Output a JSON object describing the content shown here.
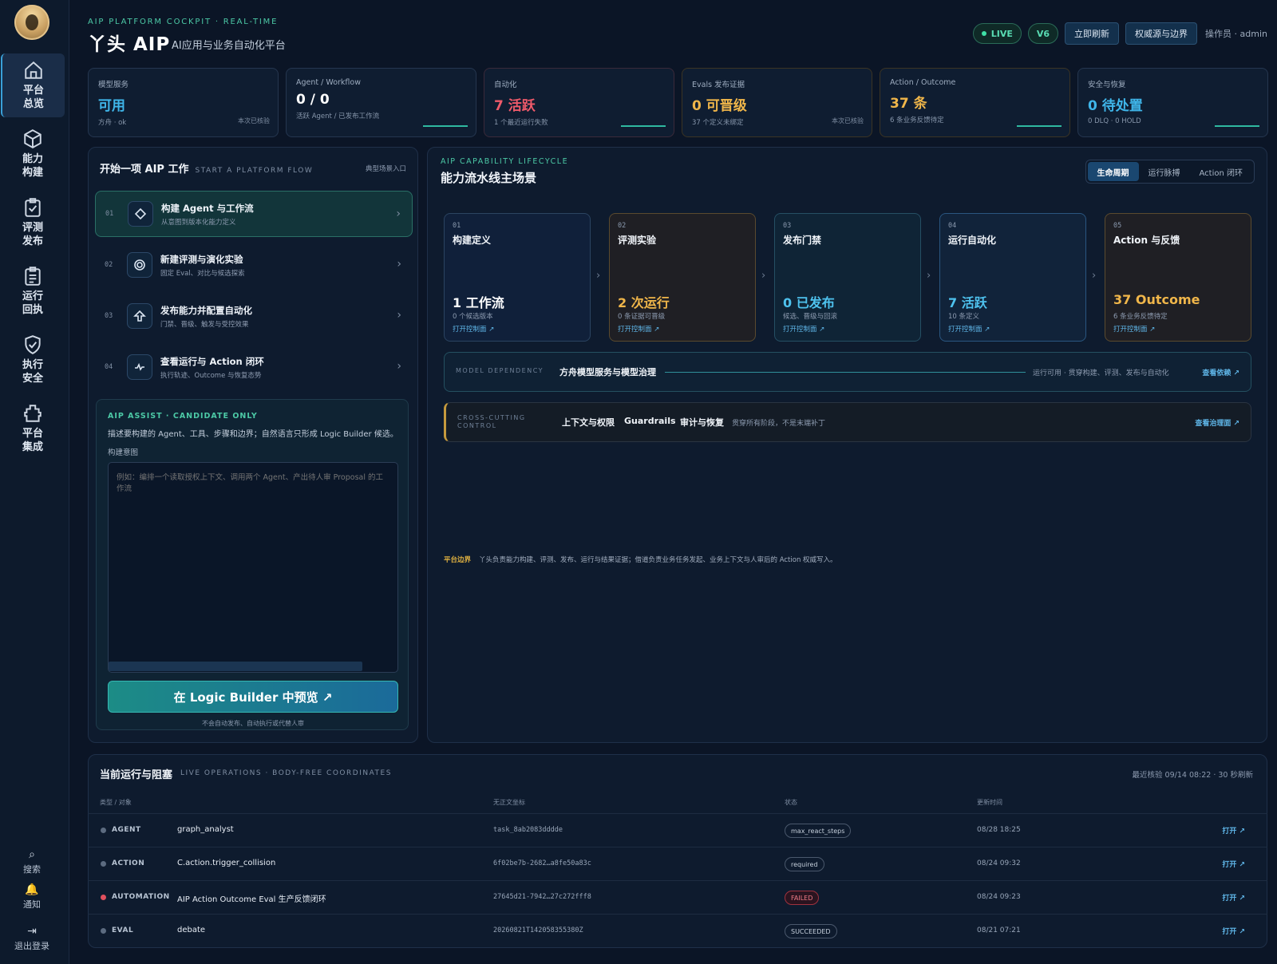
{
  "sidebar": {
    "items": [
      {
        "label": "平台总览",
        "icon": "home-icon"
      },
      {
        "label": "能力构建",
        "icon": "cube-icon"
      },
      {
        "label": "评测发布",
        "icon": "clipboard-check-icon"
      },
      {
        "label": "运行回执",
        "icon": "clipboard-list-icon"
      },
      {
        "label": "执行安全",
        "icon": "shield-check-icon"
      },
      {
        "label": "平台集成",
        "icon": "puzzle-icon"
      }
    ],
    "bottom": [
      {
        "label": "搜索",
        "glyph": "⌕",
        "icon": "search-icon"
      },
      {
        "label": "通知",
        "glyph": "🔔",
        "icon": "bell-icon"
      },
      {
        "label": "退出登录",
        "glyph": "⇥",
        "icon": "logout-icon"
      }
    ]
  },
  "header": {
    "kicker": "AIP PLATFORM COCKPIT · REAL-TIME",
    "brand": "丫头 AIP",
    "subtitle": "AI应用与业务自动化平台",
    "live": "LIVE",
    "version": "V6",
    "refresh": "立即刷新",
    "authority": "权威源与边界",
    "operator": "操作员 · admin"
  },
  "stats": [
    {
      "label": "模型服务",
      "value": "可用",
      "sub": "方舟 · ok",
      "corner": "本次已核验",
      "color": "#3fb6ea"
    },
    {
      "label": "Agent / Workflow",
      "value": "0 / 0",
      "sub": "活跃 Agent / 已发布工作流",
      "corner": "",
      "color": "#ffffff"
    },
    {
      "label": "自动化",
      "value": "7 活跃",
      "sub": "1 个最近运行失败",
      "corner": "",
      "color": "#ef5a6a"
    },
    {
      "label": "Evals 发布证据",
      "value": "0 可晋级",
      "sub": "37 个定义未绑定",
      "corner": "本次已核验",
      "color": "#f0b64a"
    },
    {
      "label": "Action / Outcome",
      "value": "37 条",
      "sub": "6 条业务反馈待定",
      "corner": "",
      "color": "#f0b64a"
    },
    {
      "label": "安全与恢复",
      "value": "0 待处置",
      "sub": "0 DLQ · 0 HOLD",
      "corner": "",
      "color": "#3fb6ea"
    }
  ],
  "flow": {
    "title": "开始一项 AIP 工作",
    "kicker": "START A PLATFORM FLOW",
    "right": "典型场景入口",
    "items": [
      {
        "num": "01",
        "title": "构建 Agent 与工作流",
        "sub": "从意图到版本化能力定义"
      },
      {
        "num": "02",
        "title": "新建评测与演化实验",
        "sub": "固定 Eval、对比与候选探索"
      },
      {
        "num": "03",
        "title": "发布能力并配置自动化",
        "sub": "门禁、晋级、触发与受控效果"
      },
      {
        "num": "04",
        "title": "查看运行与 Action 闭环",
        "sub": "执行轨迹、Outcome 与恢复态势"
      }
    ]
  },
  "assist": {
    "kicker": "AIP ASSIST · CANDIDATE ONLY",
    "desc": "描述要构建的 Agent、工具、步骤和边界；自然语言只形成 Logic Builder 候选。",
    "field": "构建意图",
    "placeholder": "例如：编排一个读取授权上下文、调用两个 Agent、产出待人审 Proposal 的工作流",
    "cta": "在 Logic Builder 中预览 ↗",
    "note": "不会自动发布、自动执行或代替人审"
  },
  "lifecycle": {
    "kicker": "AIP CAPABILITY LIFECYCLE",
    "title": "能力流水线主场景",
    "tabs": [
      "生命周期",
      "运行脉搏",
      "Action 闭环"
    ],
    "stages": [
      {
        "no": "01",
        "name": "构建定义",
        "metric": "1 工作流",
        "sub": "0 个候选版本",
        "link": "打开控制面 ↗",
        "color": "#ffffff"
      },
      {
        "no": "02",
        "name": "评测实验",
        "metric": "2 次运行",
        "sub": "0 条证据可晋级",
        "link": "打开控制面 ↗",
        "color": "#f0b64a"
      },
      {
        "no": "03",
        "name": "发布门禁",
        "metric": "0 已发布",
        "sub": "候选、晋级与回滚",
        "link": "打开控制面 ↗",
        "color": "#4ec2ee"
      },
      {
        "no": "04",
        "name": "运行自动化",
        "metric": "7 活跃",
        "sub": "10 条定义",
        "link": "打开控制面 ↗",
        "color": "#4ec2ee"
      },
      {
        "no": "05",
        "name": "Action 与反馈",
        "metric": "37 Outcome",
        "sub": "6 条业务反馈待定",
        "link": "打开控制面 ↗",
        "color": "#f0b64a"
      }
    ],
    "dependency": {
      "kicker": "MODEL DEPENDENCY",
      "title": "方舟模型服务与模型治理",
      "desc": "运行可用 · 贯穿构建、评测、发布与自动化",
      "link": "查看依赖 ↗"
    },
    "crosscut": {
      "kicker": "CROSS-CUTTING CONTROL",
      "items": [
        "上下文与权限",
        "Guardrails",
        "审计与恢复"
      ],
      "desc": "贯穿所有阶段，不是末端补丁",
      "link": "查看治理面 ↗"
    },
    "boundary_label": "平台边界",
    "boundary_text": "丫头负责能力构建、评测、发布、运行与结果证据；借道负责业务任务发起、业务上下文与人审后的 Action 权威写入。"
  },
  "ops": {
    "title": "当前运行与阻塞",
    "kicker": "LIVE OPERATIONS · BODY-FREE COORDINATES",
    "right": "最近核验 09/14 08:22 · 30 秒刷新",
    "headers": [
      "类型 / 对象",
      "无正文坐标",
      "状态",
      "更新时间"
    ],
    "rows": [
      {
        "type": "AGENT",
        "object": "graph_analyst",
        "coord": "task_8ab2083dddde",
        "status": "max_react_steps",
        "time": "08/28 18:25",
        "open": "打开 ↗"
      },
      {
        "type": "ACTION",
        "object": "C.action.trigger_collision",
        "coord": "6f02be7b-2682…a8fe50a83c",
        "status": "required",
        "time": "08/24 09:32",
        "open": "打开 ↗"
      },
      {
        "type": "AUTOMATION",
        "object": "AIP Action Outcome Eval 生产反馈闭环",
        "coord": "27645d21-7942…27c272fff8",
        "status": "FAILED",
        "time": "08/24 09:23",
        "open": "打开 ↗"
      },
      {
        "type": "EVAL",
        "object": "debate",
        "coord": "20260821T142058355380Z",
        "status": "SUCCEEDED",
        "time": "08/21 07:21",
        "open": "打开 ↗"
      }
    ]
  }
}
